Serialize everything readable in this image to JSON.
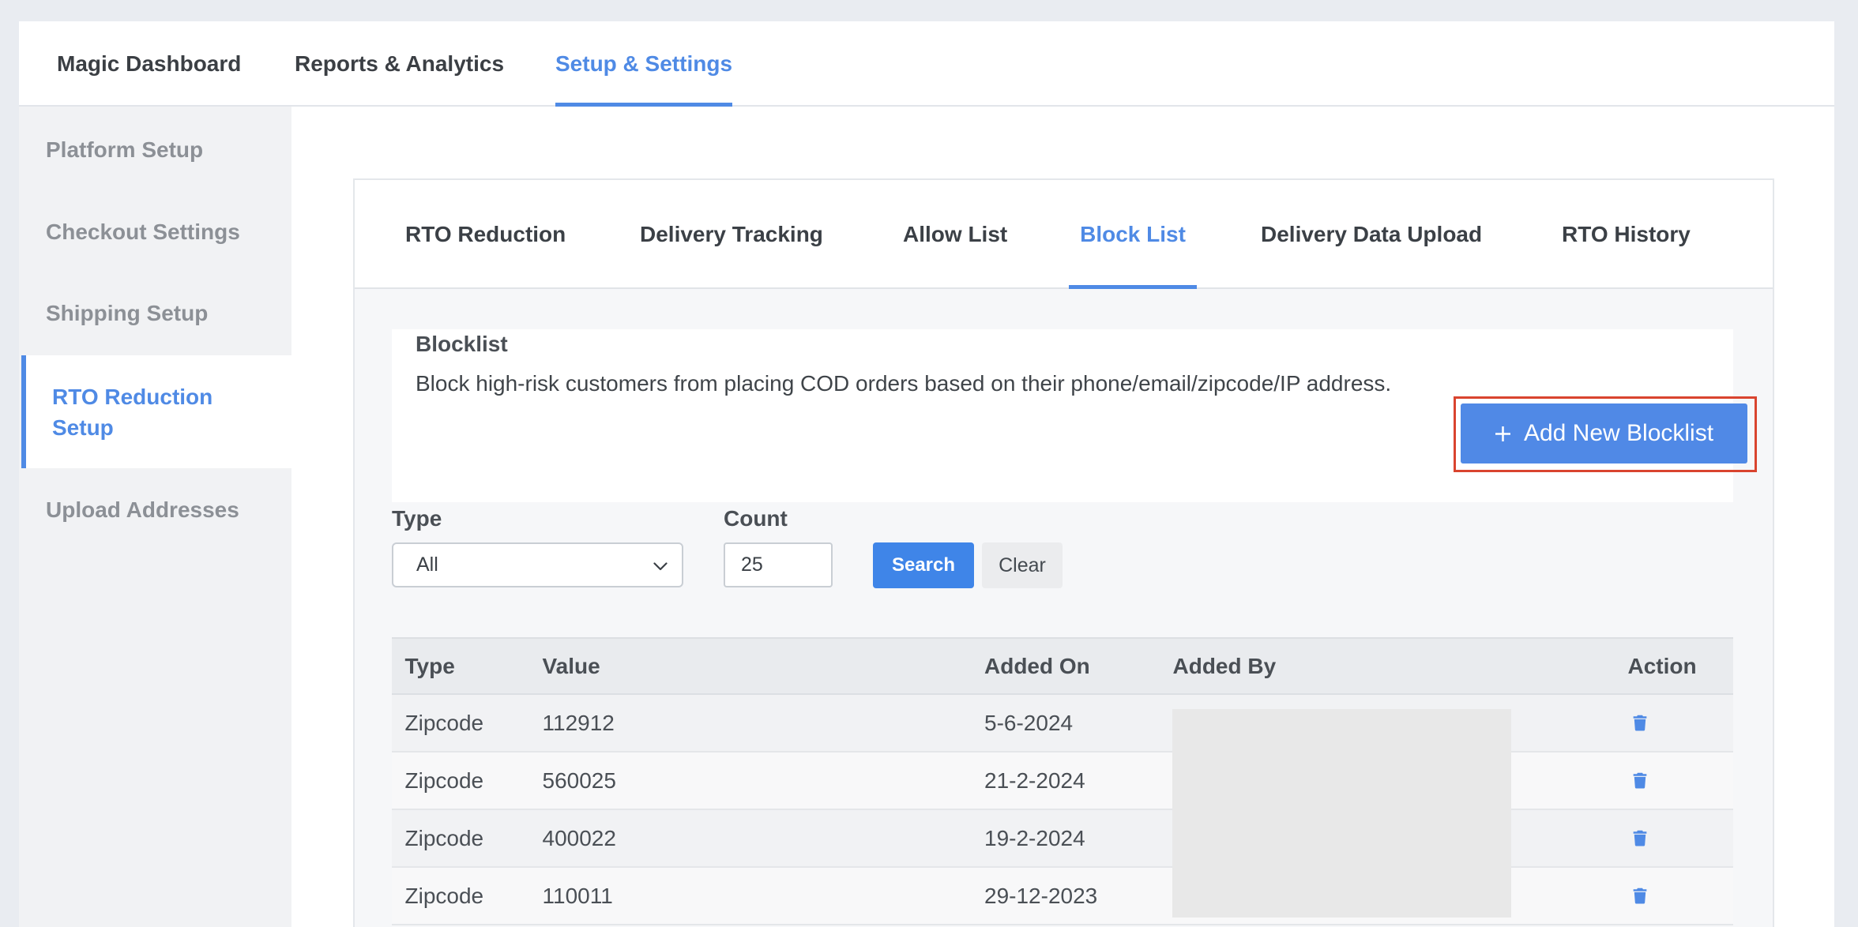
{
  "top_nav": {
    "tabs": [
      {
        "label": "Magic Dashboard",
        "active": false
      },
      {
        "label": "Reports & Analytics",
        "active": false
      },
      {
        "label": "Setup & Settings",
        "active": true
      }
    ]
  },
  "sidebar": {
    "items": [
      {
        "label": "Platform Setup",
        "active": false
      },
      {
        "label": "Checkout Settings",
        "active": false
      },
      {
        "label": "Shipping Setup",
        "active": false
      },
      {
        "label": "RTO Reduction Setup",
        "active": true
      },
      {
        "label": "Upload Addresses",
        "active": false
      }
    ]
  },
  "sub_tabs": [
    {
      "label": "RTO Reduction",
      "active": false
    },
    {
      "label": "Delivery Tracking",
      "active": false
    },
    {
      "label": "Allow List",
      "active": false
    },
    {
      "label": "Block List",
      "active": true
    },
    {
      "label": "Delivery Data Upload",
      "active": false
    },
    {
      "label": "RTO History",
      "active": false
    }
  ],
  "blocklist": {
    "title": "Blocklist",
    "description": "Block high-risk customers from placing COD orders based on their phone/email/zipcode/IP address.",
    "add_button": {
      "label": "Add New Blocklist",
      "icon": "plus-icon"
    }
  },
  "filters": {
    "type": {
      "label": "Type",
      "value": "All",
      "icon": "chevron-down-icon"
    },
    "count": {
      "label": "Count",
      "value": "25"
    },
    "search_label": "Search",
    "clear_label": "Clear"
  },
  "table": {
    "columns": [
      "Type",
      "Value",
      "Added On",
      "Added By",
      "Action"
    ],
    "rows": [
      {
        "type": "Zipcode",
        "value": "112912",
        "added_on": "5-6-2024",
        "action_icon": "trash-icon"
      },
      {
        "type": "Zipcode",
        "value": "560025",
        "added_on": "21-2-2024",
        "action_icon": "trash-icon"
      },
      {
        "type": "Zipcode",
        "value": "400022",
        "added_on": "19-2-2024",
        "action_icon": "trash-icon"
      },
      {
        "type": "Zipcode",
        "value": "110011",
        "added_on": "29-12-2023",
        "action_icon": "trash-icon"
      }
    ]
  },
  "colors": {
    "accent": "#4f8ae5",
    "button": "#5089e6",
    "highlight": "#d9442f"
  }
}
